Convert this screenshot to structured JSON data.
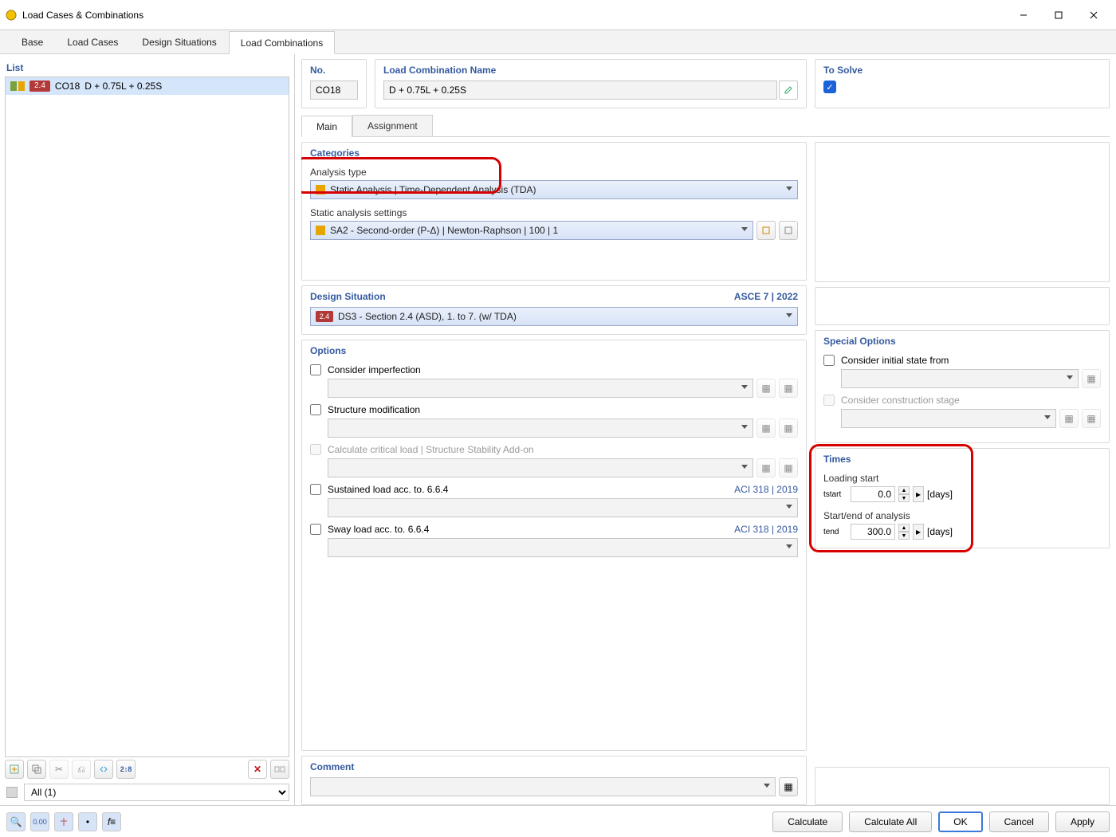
{
  "window": {
    "title": "Load Cases & Combinations"
  },
  "tabs": [
    "Base",
    "Load Cases",
    "Design Situations",
    "Load Combinations"
  ],
  "active_tab": 3,
  "list": {
    "header": "List",
    "items": [
      {
        "badge": "2.4",
        "code": "CO18",
        "desc": "D + 0.75L + 0.25S"
      }
    ],
    "filter": "All (1)"
  },
  "fields": {
    "no_label": "No.",
    "no_value": "CO18",
    "name_label": "Load Combination Name",
    "name_value": "D + 0.75L + 0.25S",
    "solve_label": "To Solve"
  },
  "subtabs": [
    "Main",
    "Assignment"
  ],
  "active_subtab": 0,
  "categories": {
    "header": "Categories",
    "analysis_type_label": "Analysis type",
    "analysis_type_value": "Static Analysis | Time-Dependent Analysis (TDA)",
    "sas_label": "Static analysis settings",
    "sas_value": "SA2 - Second-order (P-Δ) | Newton-Raphson | 100 | 1"
  },
  "design_situation": {
    "header": "Design Situation",
    "code_ref": "ASCE 7 | 2022",
    "badge": "2.4",
    "value": "DS3 - Section 2.4 (ASD), 1. to 7. (w/ TDA)"
  },
  "options": {
    "header": "Options",
    "imperfection": "Consider imperfection",
    "structmod": "Structure modification",
    "critload": "Calculate critical load | Structure Stability Add-on",
    "sustained": "Sustained load acc. to. 6.6.4",
    "sway": "Sway load acc. to. 6.6.4",
    "aci_ref": "ACI 318 | 2019"
  },
  "special": {
    "header": "Special Options",
    "initial": "Consider initial state from",
    "construction": "Consider construction stage"
  },
  "times": {
    "header": "Times",
    "loading_start_label": "Loading start",
    "tstart_sym": "tstart",
    "tstart_val": "0.0",
    "analysis_label": "Start/end of analysis",
    "tend_sym": "tend",
    "tend_val": "300.0",
    "unit": "[days]"
  },
  "comment": {
    "header": "Comment"
  },
  "footer": {
    "calculate": "Calculate",
    "calculate_all": "Calculate All",
    "ok": "OK",
    "cancel": "Cancel",
    "apply": "Apply"
  }
}
